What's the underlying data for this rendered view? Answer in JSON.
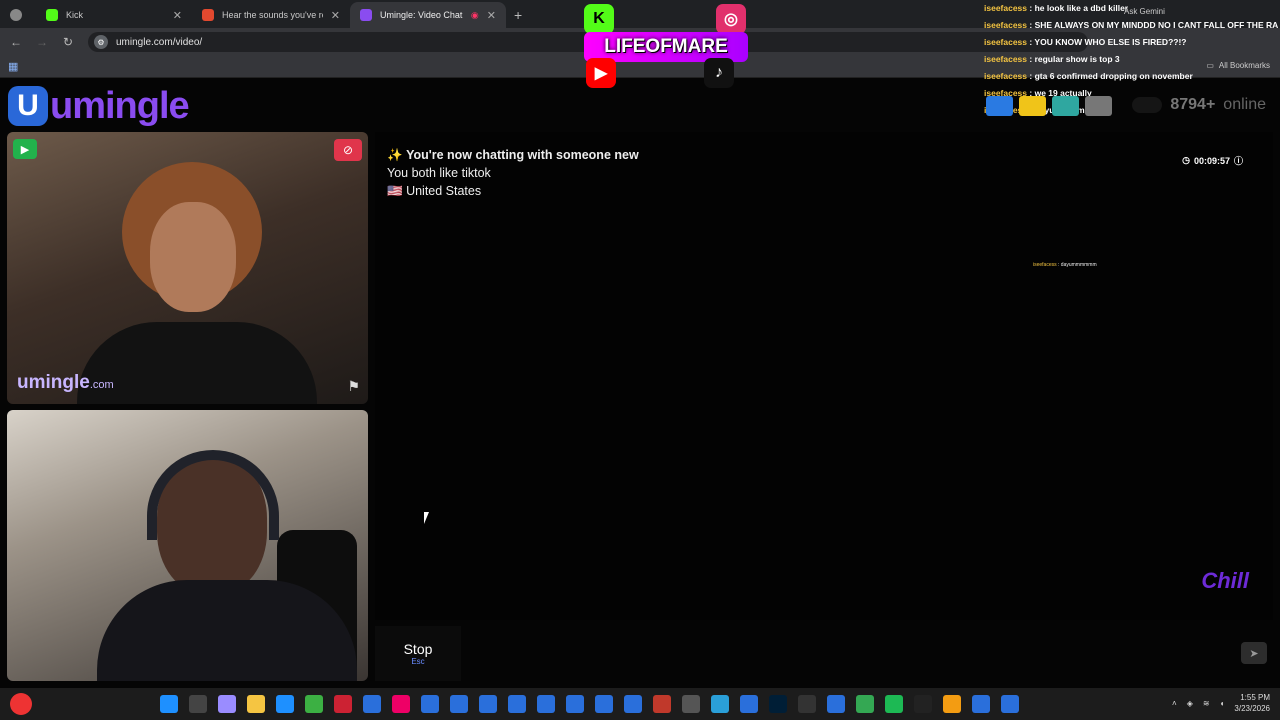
{
  "browser": {
    "tabs": [
      {
        "title": "Kick",
        "color": "#53fc18"
      },
      {
        "title": "Hear the sounds you've recently",
        "color": "#e2492f"
      },
      {
        "title": "Umingle: Video Chat with S",
        "color": "#8a4cf0",
        "active": true
      }
    ],
    "url": "umingle.com/video/",
    "ask_gemini": "Ask Gemini",
    "all_bookmarks": "All Bookmarks"
  },
  "site": {
    "logo_letter": "U",
    "logo_text": "umingle",
    "online_count": "8794+",
    "online_label": "online"
  },
  "stream_overlay": {
    "brand": "LIFEOFMARE",
    "kick_letter": "K",
    "chat": [
      {
        "user": "iseefacess",
        "text": "he look like a dbd killer"
      },
      {
        "user": "iseefacess",
        "text": "SHE ALWAYS ON MY MINDDD NO I CANT FALL OFF THE RA"
      },
      {
        "user": "iseefacess",
        "text": "YOU KNOW WHO ELSE IS FIRED??!?"
      },
      {
        "user": "iseefacess",
        "text": "regular show is top 3"
      },
      {
        "user": "iseefacess",
        "text": "gta 6 confirmed dropping on november"
      },
      {
        "user": "iseefacess",
        "text": "we 19 actually"
      },
      {
        "user": "iseefacess",
        "text": "dayummmmmm"
      }
    ],
    "mini_chat": {
      "user": "iseefacess",
      "text": "dayummmmmm"
    },
    "corner_logo": "Chill"
  },
  "video": {
    "watermark_main": "umingle",
    "watermark_suffix": ".com"
  },
  "chat_panel": {
    "sparkle": "✨",
    "title": "You're now chatting with someone new",
    "common_interest": "You both like tiktok",
    "flag": "🇺🇸",
    "country": "United States",
    "timer": "00:09:57"
  },
  "controls": {
    "stop_label": "Stop",
    "stop_key": "Esc",
    "message_placeholder": ""
  },
  "system": {
    "time": "1:55 PM",
    "date": "3/23/2026"
  },
  "taskbar_colors": [
    "#1e90ff",
    "#444",
    "#9a8cff",
    "#f5c542",
    "#1e90ff",
    "#3cb043",
    "#c23",
    "#2a6fdb",
    "#e06",
    "#2a6fdb",
    "#2a6fdb",
    "#2a6fdb",
    "#2a6fdb",
    "#2a6fdb",
    "#2a6fdb",
    "#2a6fdb",
    "#2a6fdb",
    "#c0392b",
    "#555",
    "#2a9fd8",
    "#2a6fdb",
    "#001e36",
    "#333",
    "#2a6fdb",
    "#34a853",
    "#1db954",
    "#222",
    "#f39c12",
    "#2a6fdb",
    "#2a6fdb"
  ]
}
